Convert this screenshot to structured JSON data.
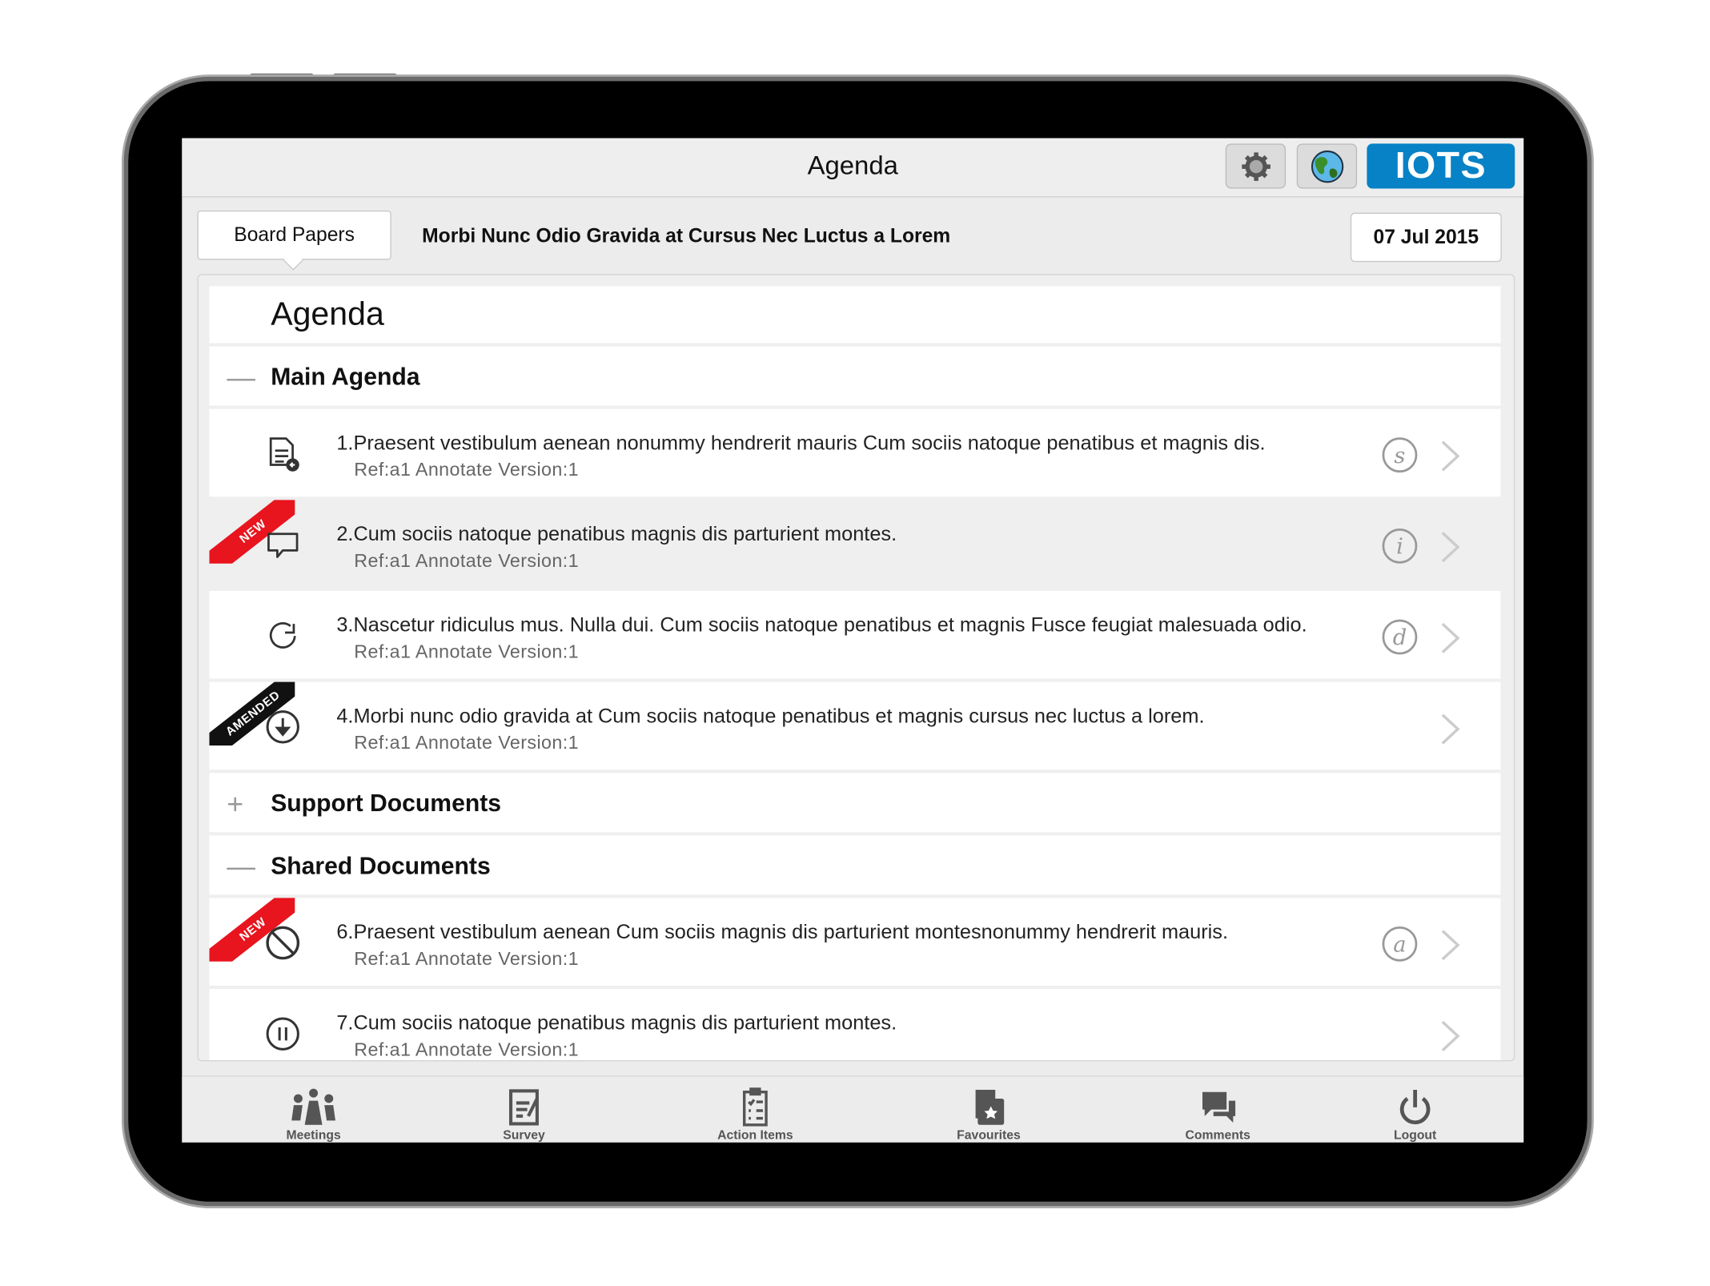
{
  "header": {
    "title": "Agenda",
    "settings_icon": "gear-icon",
    "globe_icon": "globe-icon",
    "logo": "IOTS"
  },
  "subheader": {
    "tab_label": "Board Papers",
    "meeting_title": "Morbi Nunc Odio Gravida at Cursus Nec Luctus a Lorem",
    "date": "07 Jul 2015"
  },
  "agenda": {
    "title": "Agenda",
    "sections": [
      {
        "label": "Main Agenda",
        "toggle": "—",
        "expanded": true
      },
      {
        "label": "Support Documents",
        "toggle": "+",
        "expanded": false
      },
      {
        "label": "Shared Documents",
        "toggle": "—",
        "expanded": true
      }
    ],
    "items": [
      {
        "title": "1.Praesent vestibulum aenean nonummy hendrerit mauris Cum sociis natoque penatibus et magnis dis.",
        "ref": "Ref:a1 Annotate Version:1",
        "icon": "document-add-icon",
        "badge": "s",
        "ribbon": ""
      },
      {
        "title": "2.Cum sociis natoque penatibus magnis dis parturient montes.",
        "ref": "Ref:a1 Annotate Version:1",
        "icon": "speech-bubble-icon",
        "badge": "i",
        "ribbon": "NEW"
      },
      {
        "title": "3.Nascetur ridiculus mus. Nulla dui. Cum sociis natoque penatibus et magnis Fusce feugiat malesuada odio.",
        "ref": "Ref:a1 Annotate Version:1",
        "icon": "refresh-icon",
        "badge": "d",
        "ribbon": ""
      },
      {
        "title": "4.Morbi nunc odio gravida at Cum sociis natoque penatibus et magnis cursus nec luctus a lorem.",
        "ref": "Ref:a1 Annotate Version:1",
        "icon": "download-circle-icon",
        "badge": "",
        "ribbon": "AMENDED"
      },
      {
        "title": "6.Praesent vestibulum aenean Cum sociis magnis dis parturient montesnonummy hendrerit mauris.",
        "ref": "Ref:a1 Annotate Version:1",
        "icon": "prohibited-icon",
        "badge": "a",
        "ribbon": "NEW"
      },
      {
        "title": "7.Cum sociis natoque penatibus magnis dis parturient montes.",
        "ref": "Ref:a1 Annotate Version:1",
        "icon": "pause-circle-icon",
        "badge": "",
        "ribbon": ""
      }
    ]
  },
  "tabbar": [
    {
      "label": "Meetings"
    },
    {
      "label": "Survey"
    },
    {
      "label": "Action Items"
    },
    {
      "label": "Favourites"
    },
    {
      "label": "Comments"
    },
    {
      "label": "Logout"
    }
  ],
  "colors": {
    "logo_bg": "#0782c6",
    "new_ribbon": "#e8141e",
    "amended_ribbon": "#111111"
  }
}
